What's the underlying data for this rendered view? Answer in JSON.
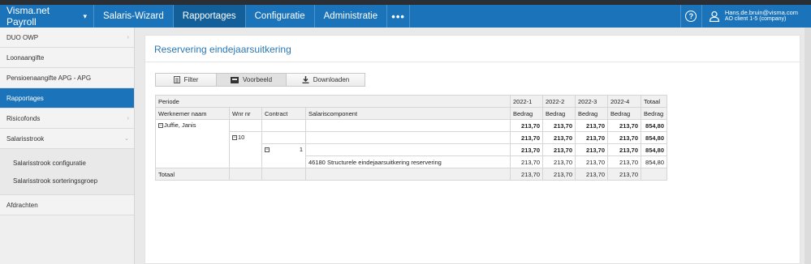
{
  "app": {
    "brand": "Visma.net Payroll",
    "nav": [
      "Salaris-Wizard",
      "Rapportages",
      "Configuratie",
      "Administratie"
    ],
    "active_nav": "Rapportages",
    "more": "•••",
    "help": "?",
    "user_name": "Hans.de.bruin@visma.com",
    "user_client": "AO client 1-5 (company)"
  },
  "sidebar": {
    "items": [
      {
        "label": "DUO OWP",
        "arrow": "›"
      },
      {
        "label": "Loonaangifte"
      },
      {
        "label": "Pensioenaangifte APG - APG"
      },
      {
        "label": "Rapportages",
        "active": true
      },
      {
        "label": "Risicofonds",
        "arrow": "›"
      },
      {
        "label": "Salarisstrook",
        "arrow": "⌄"
      }
    ],
    "subitems": [
      "Salarisstrook configuratie",
      "Salarisstrook sorteringsgroep"
    ],
    "last": "Afdrachten"
  },
  "page": {
    "title": "Reservering eindejaarsuitkering",
    "toolbar": {
      "filter": "Filter",
      "preview": "Voorbeeld",
      "download": "Downloaden"
    }
  },
  "table": {
    "periode_label": "Periode",
    "periods": [
      "2022-1",
      "2022-2",
      "2022-3",
      "2022-4"
    ],
    "totaal_label": "Totaal",
    "headers": {
      "werknemer": "Werknemer naam",
      "wnr": "Wnr nr",
      "contract": "Contract",
      "component": "Salariscomponent",
      "bedrag": "Bedrag"
    },
    "employee": "Juffie, Janis",
    "wnr": "10",
    "contract": "1",
    "component": "46180 Structurele eindejaarsuitkering reservering",
    "row_values": [
      "213,70",
      "213,70",
      "213,70",
      "213,70"
    ],
    "row_total": "854,80",
    "footer_label": "Totaal",
    "footer_values": [
      "213,70",
      "213,70",
      "213,70",
      "213,70"
    ]
  },
  "colors": {
    "accent": "#1b74ba",
    "title": "#2b78b5"
  }
}
